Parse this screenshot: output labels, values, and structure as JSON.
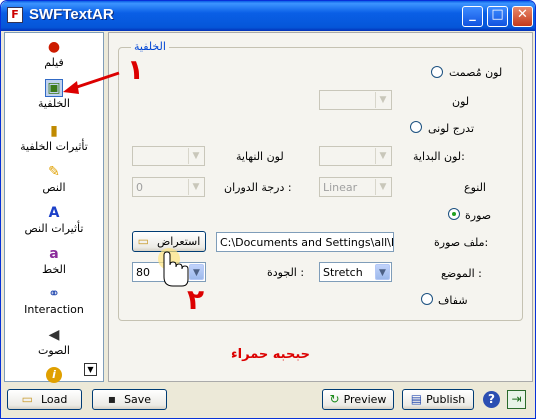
{
  "window": {
    "title": "SWFTextAR",
    "app_icon": "F",
    "minimize": "_",
    "maximize": "□",
    "close": "✕"
  },
  "sidebar": {
    "items": [
      {
        "label": "فيلم",
        "icon": "film-icon",
        "glyph": "●",
        "color": "#cc1b00"
      },
      {
        "label": "الخلفية",
        "icon": "background-icon",
        "glyph": "▣",
        "color": "#3d7a1a"
      },
      {
        "label": "تأثيرات الخلفية",
        "icon": "film-strip-icon",
        "glyph": "▮",
        "color": "#c08a00"
      },
      {
        "label": "النص",
        "icon": "pencil-icon",
        "glyph": "✎",
        "color": "#e0a000"
      },
      {
        "label": "تأثيرات النص",
        "icon": "text-effects-icon",
        "glyph": "A",
        "color": "#1c40c8"
      },
      {
        "label": "الخط",
        "icon": "font-icon",
        "glyph": "a",
        "color": "#8a2b9a"
      },
      {
        "label": "Interaction",
        "icon": "link-icon",
        "glyph": "⚭",
        "color": "#2b4fb2"
      },
      {
        "label": "الصوت",
        "icon": "speaker-icon",
        "glyph": "◀",
        "color": "#333333"
      },
      {
        "label": "",
        "icon": "info-icon",
        "glyph": "i",
        "color": "#e0a000"
      }
    ],
    "scroll_glyph": "▼"
  },
  "group": {
    "title": "الخلفية",
    "solid_color_label": "لون مُصمت",
    "color_label": "لون",
    "gradient_label": "تدرج لونى",
    "start_color_label": "لون البداية:",
    "end_color_label": "لون النهاية",
    "type_label": "النوع",
    "type_value": "Linear",
    "rotation_label": "درجة الدوران :",
    "rotation_value": "0",
    "image_label": "صورة",
    "image_file_label": "ملف صورة:",
    "image_path": "C:\\Documents and Settings\\all\\My D",
    "browse_label": "استعراض",
    "position_label": "الموضع :",
    "position_value": "Stretch",
    "quality_label": "الجودة :",
    "quality_value": "80",
    "transparent_label": "شفاف"
  },
  "annotations": {
    "number_one": "١",
    "number_two": "٢",
    "caption": "حبحبه حمراء",
    "color": "#dc0000"
  },
  "footer": {
    "load_label": "Load",
    "save_label": "Save",
    "preview_label": "Preview",
    "publish_label": "Publish",
    "help_glyph": "?",
    "exit_glyph": "⇥"
  }
}
